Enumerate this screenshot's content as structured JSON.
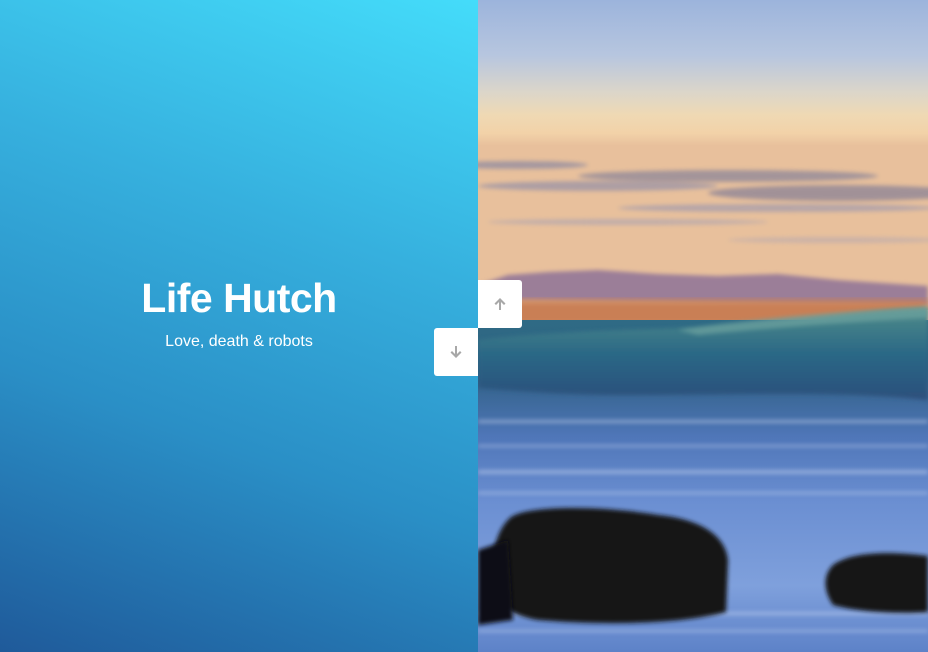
{
  "hero": {
    "title": "Life Hutch",
    "tagline": "Love, death & robots"
  },
  "navigation": {
    "up_icon": "arrow-up-icon",
    "down_icon": "arrow-down-icon"
  },
  "photo": {
    "subject": "ocean-wave-at-sunset"
  },
  "colors": {
    "gradient_top": "#44dcfa",
    "gradient_bottom": "#1f5a9a",
    "button_bg": "#ffffff",
    "arrow_color": "#a8a8a8"
  }
}
